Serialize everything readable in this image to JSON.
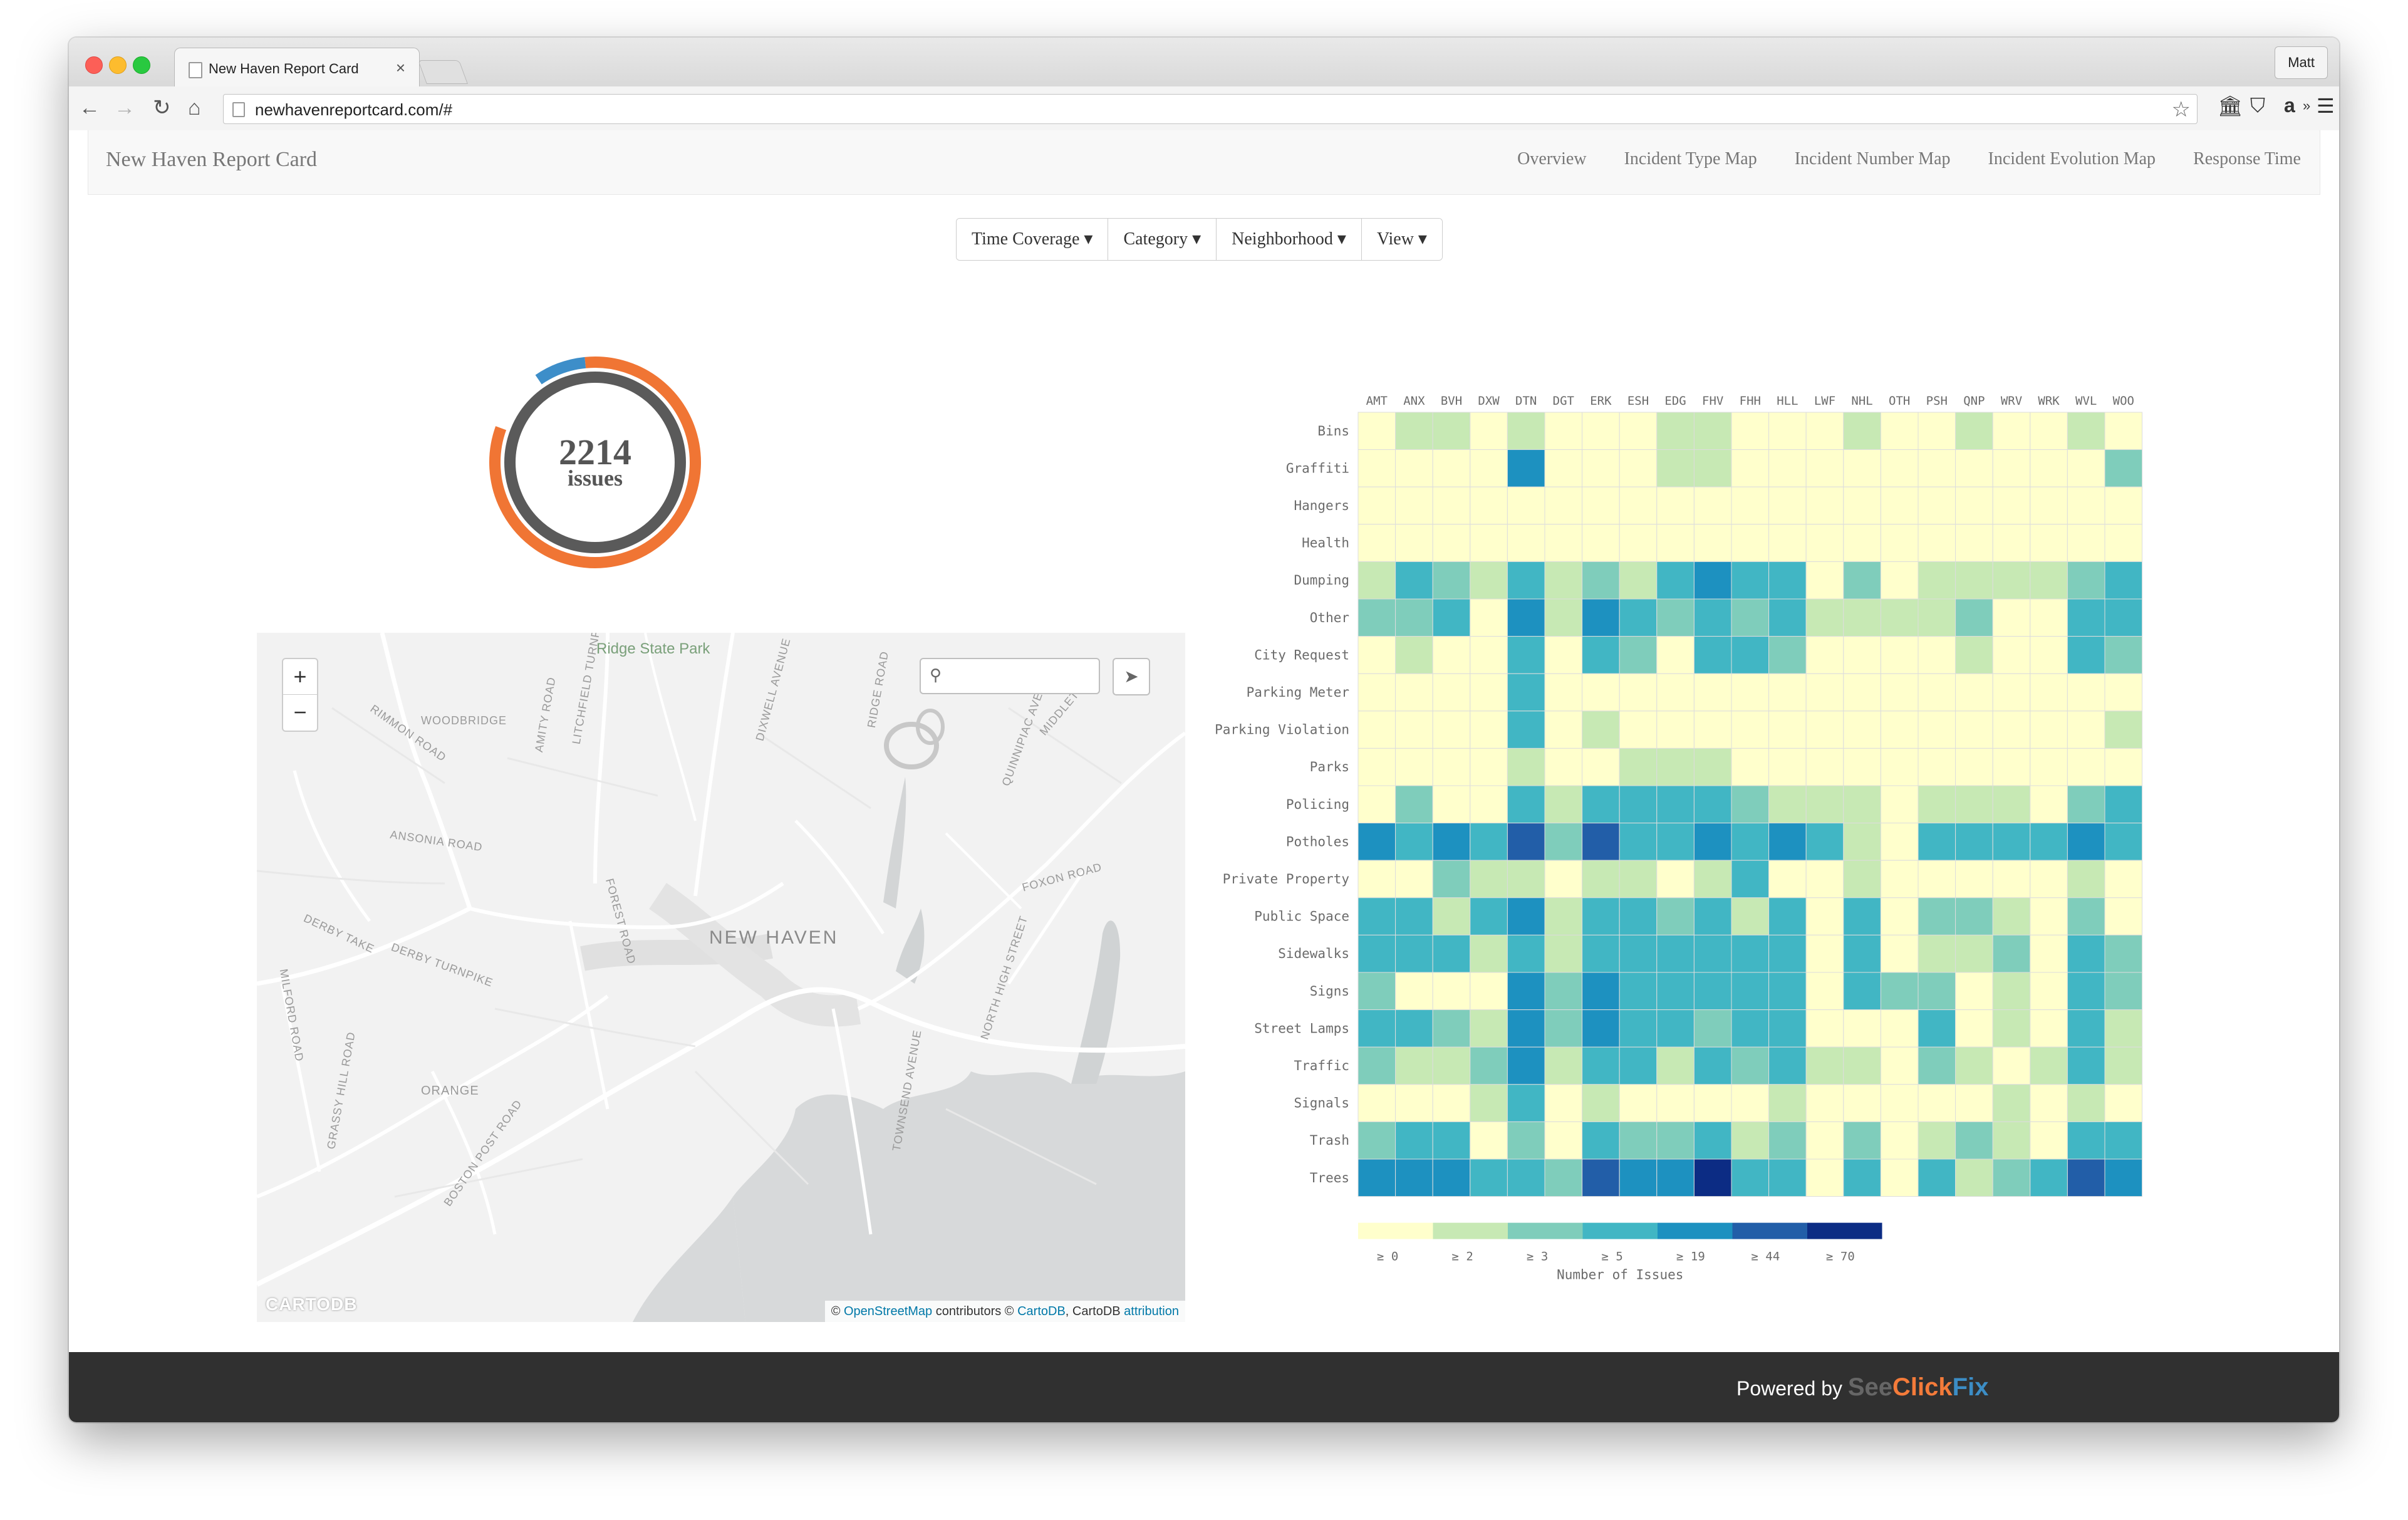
{
  "browser": {
    "tab_title": "New Haven Report Card",
    "tab_close": "×",
    "user_name": "Matt",
    "url": "newhavenreportcard.com/#",
    "nav_icons": {
      "back": "←",
      "forward": "→",
      "reload": "↻",
      "home": "⌂"
    },
    "star": "☆",
    "ext_icons": {
      "bank": "🏛",
      "pocket": "⛉",
      "amazon": "a",
      "more": "»",
      "menu": "☰"
    }
  },
  "navbar": {
    "brand": "New Haven Report Card",
    "links": [
      "Overview",
      "Incident Type Map",
      "Incident Number Map",
      "Incident Evolution Map",
      "Response Time"
    ]
  },
  "filters": [
    "Time Coverage ▾",
    "Category ▾",
    "Neighborhood ▾",
    "View ▾"
  ],
  "summary": {
    "count": "2214",
    "label": "issues",
    "ring_orange_fraction": 0.96,
    "ring_blue_fraction": 0.04
  },
  "map": {
    "zoom_in": "+",
    "zoom_out": "−",
    "search_icon": "⚲",
    "locate_icon": "➤",
    "labels": {
      "park": "Ridge State Park",
      "city": "NEW HAVEN",
      "orange": "ORANGE",
      "roads": [
        "WOODBRIDGE",
        "RIMMON ROAD",
        "AMITY ROAD",
        "LITCHFIELD TURNPIKE",
        "DIXWELL AVENUE",
        "RIDGE ROAD",
        "QUINNIPIAC AVENUE",
        "MIDDLETOWN",
        "ANSONIA ROAD",
        "FOXON ROAD",
        "DERBY TAKE",
        "DERBY TURNPIKE",
        "FOREST ROAD",
        "NORTH HIGH STREET",
        "MILFORD ROAD",
        "GRASSY HILL ROAD",
        "BOSTON POST ROAD",
        "TOWNSEND AVENUE"
      ]
    },
    "logo": "CARTODB",
    "attribution": {
      "prefix": "© ",
      "osm": "OpenStreetMap",
      "mid": " contributors © ",
      "cartodb": "CartoDB",
      "mid2": ", CartoDB ",
      "attribution": "attribution"
    }
  },
  "chart_data": {
    "type": "heatmap",
    "columns": [
      "AMT",
      "ANX",
      "BVH",
      "DXW",
      "DTN",
      "DGT",
      "ERK",
      "ESH",
      "EDG",
      "FHV",
      "FHH",
      "HLL",
      "LWF",
      "NHL",
      "OTH",
      "PSH",
      "QNP",
      "WRV",
      "WRK",
      "WVL",
      "WOO"
    ],
    "rows": [
      "Bins",
      "Graffiti",
      "Hangers",
      "Health",
      "Dumping",
      "Other",
      "City Request",
      "Parking Meter",
      "Parking Violation",
      "Parks",
      "Policing",
      "Potholes",
      "Private Property",
      "Public Space",
      "Sidewalks",
      "Signs",
      "Street Lamps",
      "Traffic",
      "Signals",
      "Trash",
      "Trees"
    ],
    "bucket_note": "cells hold bucket index 0-6 matching legend thresholds",
    "values": [
      [
        0,
        1,
        1,
        0,
        1,
        0,
        0,
        0,
        1,
        1,
        0,
        0,
        0,
        1,
        0,
        0,
        1,
        0,
        0,
        1,
        0
      ],
      [
        0,
        0,
        0,
        0,
        4,
        0,
        0,
        0,
        1,
        1,
        0,
        0,
        0,
        0,
        0,
        0,
        0,
        0,
        0,
        0,
        2
      ],
      [
        0,
        0,
        0,
        0,
        0,
        0,
        0,
        0,
        0,
        0,
        0,
        0,
        0,
        0,
        0,
        0,
        0,
        0,
        0,
        0,
        0
      ],
      [
        0,
        0,
        0,
        0,
        0,
        0,
        0,
        0,
        0,
        0,
        0,
        0,
        0,
        0,
        0,
        0,
        0,
        0,
        0,
        0,
        0
      ],
      [
        1,
        3,
        2,
        1,
        3,
        1,
        2,
        1,
        3,
        4,
        3,
        3,
        0,
        2,
        0,
        1,
        1,
        1,
        1,
        2,
        3
      ],
      [
        2,
        2,
        3,
        0,
        4,
        1,
        4,
        3,
        2,
        3,
        2,
        3,
        1,
        1,
        1,
        1,
        2,
        0,
        0,
        3,
        3
      ],
      [
        0,
        1,
        0,
        0,
        3,
        0,
        3,
        2,
        0,
        3,
        3,
        2,
        0,
        0,
        0,
        0,
        1,
        0,
        0,
        3,
        2
      ],
      [
        0,
        0,
        0,
        0,
        3,
        0,
        0,
        0,
        0,
        0,
        0,
        0,
        0,
        0,
        0,
        0,
        0,
        0,
        0,
        0,
        0
      ],
      [
        0,
        0,
        0,
        0,
        3,
        0,
        1,
        0,
        0,
        0,
        0,
        0,
        0,
        0,
        0,
        0,
        0,
        0,
        0,
        0,
        1
      ],
      [
        0,
        0,
        0,
        0,
        1,
        0,
        0,
        1,
        1,
        1,
        0,
        0,
        0,
        0,
        0,
        0,
        0,
        0,
        0,
        0,
        0
      ],
      [
        0,
        2,
        0,
        0,
        3,
        1,
        3,
        3,
        3,
        3,
        2,
        1,
        1,
        1,
        0,
        1,
        1,
        1,
        0,
        2,
        3
      ],
      [
        4,
        3,
        4,
        3,
        5,
        2,
        5,
        3,
        3,
        4,
        3,
        4,
        3,
        1,
        0,
        3,
        3,
        3,
        3,
        4,
        3
      ],
      [
        0,
        0,
        2,
        1,
        1,
        0,
        1,
        1,
        0,
        1,
        3,
        0,
        0,
        1,
        0,
        0,
        0,
        0,
        0,
        1,
        0
      ],
      [
        3,
        3,
        1,
        3,
        4,
        1,
        3,
        3,
        2,
        3,
        1,
        3,
        0,
        3,
        0,
        2,
        2,
        1,
        0,
        2,
        0
      ],
      [
        3,
        3,
        3,
        1,
        3,
        1,
        3,
        3,
        3,
        3,
        3,
        3,
        0,
        3,
        0,
        1,
        1,
        2,
        0,
        3,
        2
      ],
      [
        2,
        0,
        0,
        0,
        4,
        2,
        4,
        3,
        3,
        3,
        3,
        3,
        0,
        3,
        2,
        2,
        0,
        1,
        0,
        3,
        2
      ],
      [
        3,
        3,
        2,
        1,
        4,
        2,
        4,
        3,
        3,
        2,
        3,
        3,
        0,
        0,
        0,
        3,
        0,
        1,
        0,
        3,
        1
      ],
      [
        2,
        1,
        1,
        2,
        4,
        1,
        3,
        3,
        1,
        3,
        2,
        3,
        1,
        1,
        0,
        2,
        1,
        0,
        1,
        3,
        1
      ],
      [
        0,
        0,
        0,
        1,
        3,
        0,
        1,
        0,
        0,
        0,
        0,
        1,
        0,
        0,
        0,
        0,
        0,
        1,
        0,
        1,
        0
      ],
      [
        2,
        3,
        3,
        0,
        2,
        0,
        3,
        2,
        2,
        3,
        1,
        2,
        0,
        2,
        0,
        1,
        2,
        1,
        0,
        3,
        3
      ],
      [
        4,
        4,
        4,
        3,
        3,
        2,
        5,
        4,
        4,
        6,
        3,
        3,
        0,
        3,
        0,
        3,
        1,
        2,
        3,
        5,
        4
      ]
    ],
    "legend": {
      "labels": [
        "≥ 0",
        "≥ 2",
        "≥ 3",
        "≥ 5",
        "≥ 19",
        "≥ 44",
        "≥ 70"
      ],
      "colors": [
        "#ffffcc",
        "#c7e9b4",
        "#7fcdbb",
        "#41b6c4",
        "#1d91c0",
        "#225ea8",
        "#0c2c84"
      ],
      "title": "Number of Issues"
    },
    "grid_color": "#dddddd"
  },
  "footer": {
    "powered_by": "Powered by",
    "brand_see": "See",
    "brand_click": "Click",
    "brand_fix": "Fix"
  },
  "colors": {
    "ring_orange": "#f07534",
    "ring_blue": "#3d8ec9",
    "ring_inner": "#5a5a5a"
  }
}
